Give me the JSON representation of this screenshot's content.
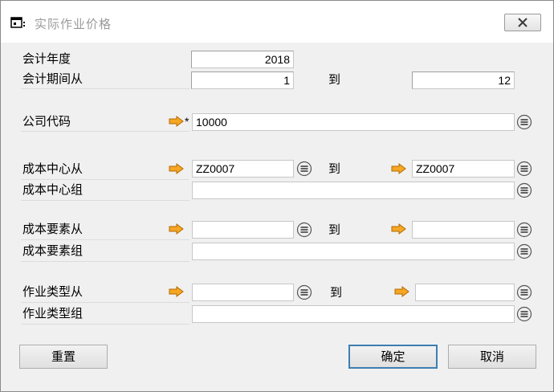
{
  "window": {
    "title": "实际作业价格"
  },
  "fields": {
    "fiscal_year": {
      "label": "会计年度",
      "value": "2018"
    },
    "period_from": {
      "label": "会计期间从",
      "value": "1"
    },
    "period_to": {
      "value": "12"
    },
    "company_code": {
      "label": "公司代码",
      "required_mark": "*",
      "value": "10000"
    },
    "cost_center_from": {
      "label": "成本中心从",
      "value": "ZZ0007"
    },
    "cost_center_to": {
      "value": "ZZ0007"
    },
    "cost_center_group": {
      "label": "成本中心组",
      "value": ""
    },
    "cost_element_from": {
      "label": "成本要素从",
      "value": ""
    },
    "cost_element_to": {
      "value": ""
    },
    "cost_element_group": {
      "label": "成本要素组",
      "value": ""
    },
    "activity_type_from": {
      "label": "作业类型从",
      "value": ""
    },
    "activity_type_to": {
      "value": ""
    },
    "activity_type_group": {
      "label": "作业类型组",
      "value": ""
    }
  },
  "to_label": "到",
  "buttons": {
    "reset": "重置",
    "ok": "确定",
    "cancel": "取消"
  },
  "colors": {
    "arrow": "#f5a623",
    "default_button_border": "#3c7fb1"
  }
}
